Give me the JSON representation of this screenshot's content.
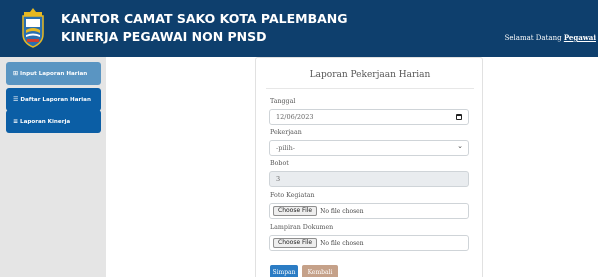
{
  "header": {
    "title_line1": "KANTOR CAMAT SAKO KOTA PALEMBANG",
    "title_line2": "KINERJA PEGAWAI NON PNSD",
    "welcome_prefix": "Selamat Datang",
    "welcome_user": "Pegawai"
  },
  "sidebar": {
    "items": [
      {
        "icon": "⊞",
        "label": "Input Laporan Harian"
      },
      {
        "icon": "☰",
        "label": "Daftar Laporan Harian"
      },
      {
        "icon": "≡",
        "label": "Laporan Kinerja"
      }
    ]
  },
  "form": {
    "title": "Laporan Pekerjaan Harian",
    "tanggal_label": "Tanggal",
    "tanggal_value": "12/06/2023",
    "pekerjaan_label": "Pekerjaan",
    "pekerjaan_value": "-pilih-",
    "bobot_label": "Bobot",
    "bobot_value": "3",
    "foto_label": "Foto Kegiatan",
    "lampiran_label": "Lampiran Dokumen",
    "file_button": "Choose File",
    "file_status": "No file chosen",
    "save_label": "Simpan",
    "back_label": "Kembali"
  },
  "colors": {
    "header_bg": "#0e3f6d",
    "sidebar_active": "#5a95c2",
    "sidebar_item": "#0b5ea5",
    "save_button": "#2b7cc4",
    "back_button": "#c5a189"
  }
}
